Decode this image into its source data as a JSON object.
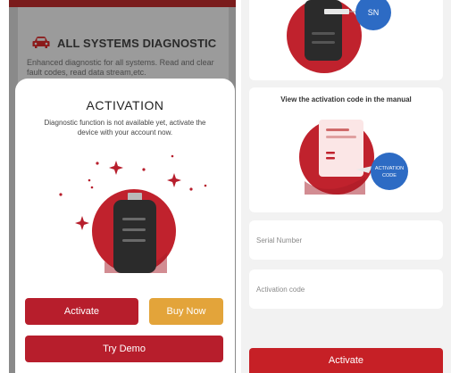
{
  "left": {
    "diagnostic_card": {
      "title": "ALL SYSTEMS DIAGNOSTIC",
      "description": "Enhanced diagnostic for all systems. Read and clear fault codes, read data stream,etc."
    },
    "activation_sheet": {
      "title": "ACTIVATION",
      "description": "Diagnostic function is not available yet, activate the device with your account now.",
      "buttons": {
        "activate": "Activate",
        "buy_now": "Buy Now",
        "try_demo": "Try Demo"
      }
    }
  },
  "right": {
    "sn_badge": "SN",
    "manual_card": {
      "title": "View the activation code in the manual",
      "badge_line1": "ACTIVATION",
      "badge_line2": "CODE"
    },
    "serial_number": {
      "value": "",
      "placeholder": "Serial Number"
    },
    "activation_code": {
      "value": "",
      "placeholder": "Activation code"
    },
    "activate_button": "Activate"
  },
  "colors": {
    "brand_red": "#b71e2c",
    "accent_gold": "#e3a43a",
    "badge_blue": "#2d6bc4"
  }
}
